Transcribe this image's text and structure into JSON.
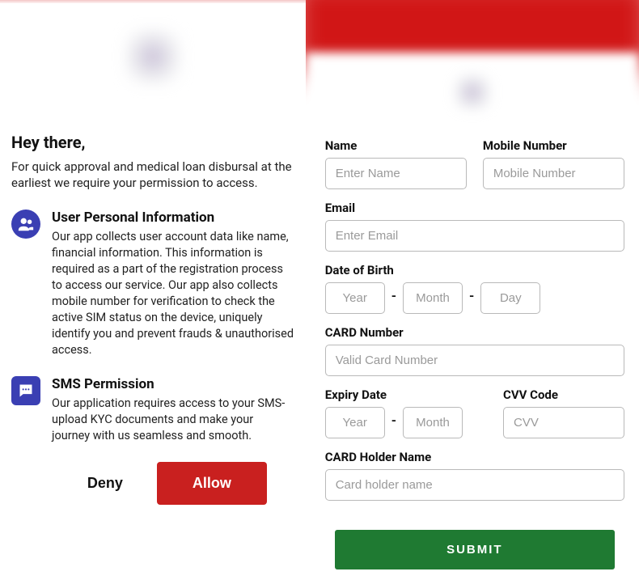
{
  "left": {
    "greeting": "Hey there,",
    "subtext": "For quick approval and medical loan disbursal at the earliest we require your permission to access.",
    "perm1": {
      "title": "User Personal Information",
      "body": "Our app collects user account data like name, financial information. This information is required as a part of the registration process to access our service. Our app also collects mobile number for verification to check the active SIM status on the device, uniquely identify you and prevent frauds & unauthorised access."
    },
    "perm2": {
      "title": "SMS Permission",
      "body": "Our application requires access to your SMS-upload KYC documents and make your journey with us seamless and smooth."
    },
    "buttons": {
      "deny": "Deny",
      "allow": "Allow"
    }
  },
  "form": {
    "name_label": "Name",
    "name_placeholder": "Enter Name",
    "mobile_label": "Mobile Number",
    "mobile_placeholder": "Mobile Number",
    "email_label": "Email",
    "email_placeholder": "Enter Email",
    "dob_label": "Date of Birth",
    "dob_year_placeholder": "Year",
    "dob_month_placeholder": "Month",
    "dob_day_placeholder": "Day",
    "dash": "-",
    "card_label": "CARD Number",
    "card_placeholder": "Valid Card Number",
    "expiry_label": "Expiry Date",
    "expiry_year_placeholder": "Year",
    "expiry_month_placeholder": "Month",
    "cvv_label": "CVV Code",
    "cvv_placeholder": "CVV",
    "holder_label": "CARD Holder Name",
    "holder_placeholder": "Card holder name",
    "submit": "SUBMIT"
  }
}
